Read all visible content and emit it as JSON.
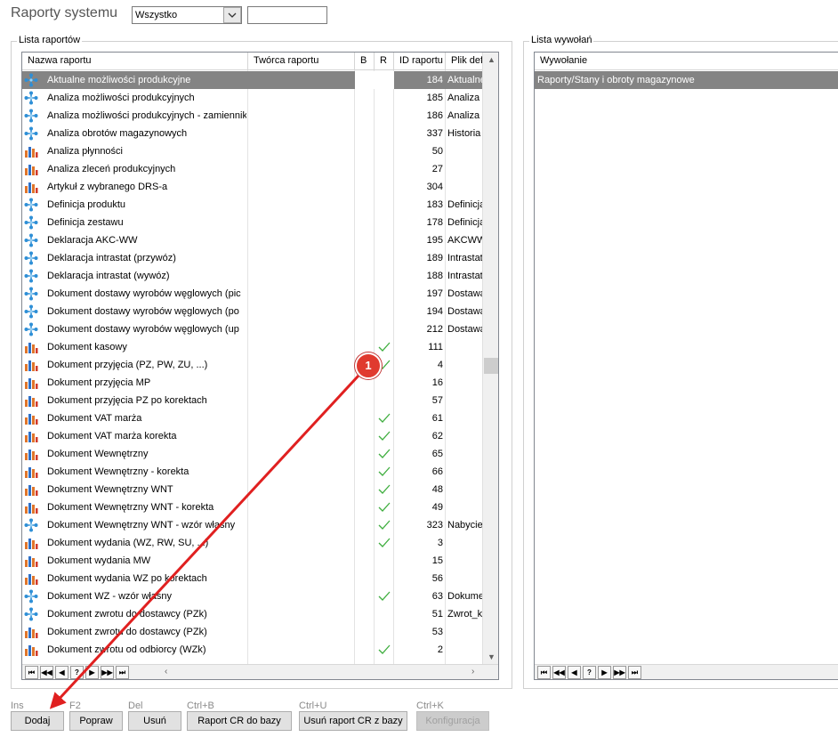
{
  "header": {
    "title": "Raporty systemu",
    "filter_value": "Wszystko",
    "search_value": ""
  },
  "reports_panel": {
    "legend": "Lista raportów",
    "columns": [
      "Nazwa raportu",
      "Twórca raportu",
      "B",
      "R",
      "ID raportu",
      "Plik def"
    ],
    "rows": [
      {
        "icon": "crystal",
        "name": "Aktualne możliwości produkcyjne",
        "check": false,
        "id": "184",
        "file": "Aktualne"
      },
      {
        "icon": "crystal",
        "name": "Analiza możliwości produkcyjnych",
        "check": false,
        "id": "185",
        "file": "Analiza"
      },
      {
        "icon": "crystal",
        "name": "Analiza możliwości produkcyjnych - zamiennik",
        "check": false,
        "id": "186",
        "file": "Analiza"
      },
      {
        "icon": "crystal",
        "name": "Analiza obrotów magazynowych",
        "check": false,
        "id": "337",
        "file": "Historia"
      },
      {
        "icon": "chart",
        "name": "Analiza płynności",
        "check": false,
        "id": "50",
        "file": ""
      },
      {
        "icon": "chart",
        "name": "Analiza zleceń produkcyjnych",
        "check": false,
        "id": "27",
        "file": ""
      },
      {
        "icon": "chart",
        "name": "Artykuł z wybranego DRS-a",
        "check": false,
        "id": "304",
        "file": ""
      },
      {
        "icon": "crystal",
        "name": "Definicja produktu",
        "check": false,
        "id": "183",
        "file": "Definicja"
      },
      {
        "icon": "crystal",
        "name": "Definicja zestawu",
        "check": false,
        "id": "178",
        "file": "Definicja"
      },
      {
        "icon": "crystal",
        "name": "Deklaracja AKC-WW",
        "check": false,
        "id": "195",
        "file": "AKCWW"
      },
      {
        "icon": "crystal",
        "name": "Deklaracja intrastat (przywóz)",
        "check": false,
        "id": "189",
        "file": "Intrastat"
      },
      {
        "icon": "crystal",
        "name": "Deklaracja intrastat (wywóz)",
        "check": false,
        "id": "188",
        "file": "Intrastat"
      },
      {
        "icon": "crystal",
        "name": "Dokument dostawy wyrobów węglowych (pic",
        "check": false,
        "id": "197",
        "file": "Dostawa"
      },
      {
        "icon": "crystal",
        "name": "Dokument dostawy wyrobów węglowych (po",
        "check": false,
        "id": "194",
        "file": "Dostawa"
      },
      {
        "icon": "crystal",
        "name": "Dokument dostawy wyrobów węglowych (up",
        "check": false,
        "id": "212",
        "file": "Dostawa"
      },
      {
        "icon": "chart",
        "name": "Dokument kasowy",
        "check": true,
        "id": "111",
        "file": ""
      },
      {
        "icon": "chart",
        "name": "Dokument przyjęcia (PZ, PW, ZU, ...)",
        "check": true,
        "id": "4",
        "file": ""
      },
      {
        "icon": "chart",
        "name": "Dokument przyjęcia MP",
        "check": false,
        "id": "16",
        "file": ""
      },
      {
        "icon": "chart",
        "name": "Dokument przyjęcia PZ po korektach",
        "check": false,
        "id": "57",
        "file": ""
      },
      {
        "icon": "chart",
        "name": "Dokument VAT marża",
        "check": true,
        "id": "61",
        "file": ""
      },
      {
        "icon": "chart",
        "name": "Dokument VAT marża korekta",
        "check": true,
        "id": "62",
        "file": ""
      },
      {
        "icon": "chart",
        "name": "Dokument Wewnętrzny",
        "check": true,
        "id": "65",
        "file": ""
      },
      {
        "icon": "chart",
        "name": "Dokument Wewnętrzny - korekta",
        "check": true,
        "id": "66",
        "file": ""
      },
      {
        "icon": "chart",
        "name": "Dokument Wewnętrzny WNT",
        "check": true,
        "id": "48",
        "file": ""
      },
      {
        "icon": "chart",
        "name": "Dokument Wewnętrzny WNT - korekta",
        "check": true,
        "id": "49",
        "file": ""
      },
      {
        "icon": "crystal",
        "name": "Dokument Wewnętrzny WNT - wzór własny",
        "check": true,
        "id": "323",
        "file": "Nabycie"
      },
      {
        "icon": "chart",
        "name": "Dokument wydania (WZ, RW, SU, ...)",
        "check": true,
        "id": "3",
        "file": ""
      },
      {
        "icon": "chart",
        "name": "Dokument wydania MW",
        "check": false,
        "id": "15",
        "file": ""
      },
      {
        "icon": "chart",
        "name": "Dokument wydania WZ po korektach",
        "check": false,
        "id": "56",
        "file": ""
      },
      {
        "icon": "crystal",
        "name": "Dokument WZ - wzór własny",
        "check": true,
        "id": "63",
        "file": "Dokumen"
      },
      {
        "icon": "crystal",
        "name": "Dokument zwrotu do dostawcy (PZk)",
        "check": false,
        "id": "51",
        "file": "Zwrot_k"
      },
      {
        "icon": "chart",
        "name": "Dokument zwrotu do dostawcy (PZk)",
        "check": false,
        "id": "53",
        "file": ""
      },
      {
        "icon": "chart",
        "name": "Dokument zwrotu od odbiorcy (WZk)",
        "check": true,
        "id": "2",
        "file": ""
      }
    ],
    "nav_buttons": [
      "⏮",
      "◀◀",
      "◀",
      "?",
      "▶",
      "▶▶",
      "⏭"
    ]
  },
  "calls_panel": {
    "legend": "Lista wywołań",
    "column": "Wywołanie",
    "rows": [
      "Raporty/Stany i obroty magazynowe"
    ],
    "nav_buttons": [
      "⏮",
      "◀◀",
      "◀",
      "?",
      "▶",
      "▶▶",
      "⏭"
    ]
  },
  "toolbar": {
    "buttons": [
      {
        "key": "Ins",
        "label": "Dodaj"
      },
      {
        "key": "F2",
        "label": "Popraw"
      },
      {
        "key": "Del",
        "label": "Usuń"
      },
      {
        "key": "Ctrl+B",
        "label": "Raport CR do bazy"
      },
      {
        "key": "Ctrl+U",
        "label": "Usuń raport CR z bazy"
      },
      {
        "key": "Ctrl+K",
        "label": "Konfiguracja"
      }
    ]
  },
  "annotation": {
    "label": "1",
    "color": "#e02020"
  },
  "colors": {
    "selected_row": "#848484",
    "check": "#3fae3f",
    "crystal_icon": "#2e8fd6",
    "chart_icon": "#e0752a"
  }
}
